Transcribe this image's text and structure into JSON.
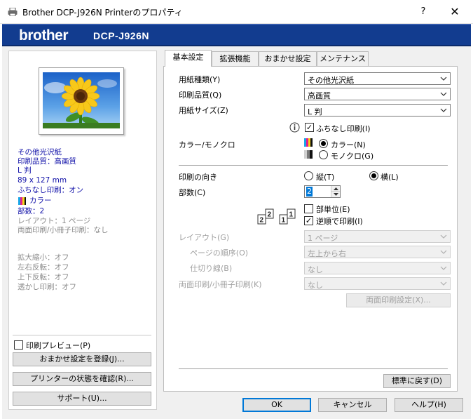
{
  "window": {
    "title": "Brother DCP-J926N Printerのプロパティ",
    "help": "?",
    "close": "✕"
  },
  "banner": {
    "logo": "brother",
    "model": "DCP-J926N",
    "brand_color": "#123c8f"
  },
  "summary": {
    "media": "その他光沢紙",
    "quality": "印刷品質：高画質",
    "size": "L 判",
    "dimensions": "89 x 127 mm",
    "borderless": "ふちなし印刷：オン",
    "color": "カラー",
    "copies": "部数：2",
    "layout": "レイアウト：1 ページ",
    "duplex": "両面印刷/小冊子印刷：なし",
    "scaling": "拡大縮小：オフ",
    "mirror": "左右反転：オフ",
    "flip": "上下反転：オフ",
    "watermark": "透かし印刷：オフ"
  },
  "left_controls": {
    "preview_label": "印刷プレビュー(P)",
    "preview_checked": false,
    "register_button": "おまかせ設定を登録(J)...",
    "status_button": "プリンターの状態を確認(R)...",
    "support_button": "サポート(U)..."
  },
  "tabs": [
    {
      "label": "基本設定",
      "active": true
    },
    {
      "label": "拡張機能",
      "active": false
    },
    {
      "label": "おまかせ設定",
      "active": false
    },
    {
      "label": "メンテナンス",
      "active": false
    }
  ],
  "basic": {
    "media_type": {
      "label": "用紙種類(Y)",
      "value": "その他光沢紙"
    },
    "quality": {
      "label": "印刷品質(Q)",
      "value": "高画質"
    },
    "paper_size": {
      "label": "用紙サイズ(Z)",
      "value": "L 判"
    },
    "borderless": {
      "label": "ふちなし印刷(I)",
      "checked": true,
      "info_icon": "info-icon"
    },
    "color_mode": {
      "label": "カラー/モノクロ",
      "color_option": "カラー(N)",
      "mono_option": "モノクロ(G)",
      "selected": "color"
    },
    "orientation": {
      "label": "印刷の向き",
      "portrait": "縦(T)",
      "landscape": "横(L)",
      "selected": "landscape"
    },
    "copies": {
      "label": "部数(C)",
      "value": "2"
    },
    "collate": {
      "label": "部単位(E)",
      "checked": false
    },
    "reverse": {
      "label": "逆順で印刷(I)",
      "checked": true
    },
    "layout": {
      "label": "レイアウト(G)",
      "value": "1 ページ"
    },
    "page_order": {
      "label": "ページの順序(O)",
      "value": "左上から右"
    },
    "border_line": {
      "label": "仕切り線(B)",
      "value": "なし"
    },
    "duplex": {
      "label": "両面印刷/小冊子印刷(K)",
      "value": "なし"
    },
    "duplex_settings_button": "両面印刷設定(X)...",
    "defaults_button": "標準に戻す(D)"
  },
  "footer": {
    "ok": "OK",
    "cancel": "キャンセル",
    "help": "ヘルプ(H)"
  }
}
